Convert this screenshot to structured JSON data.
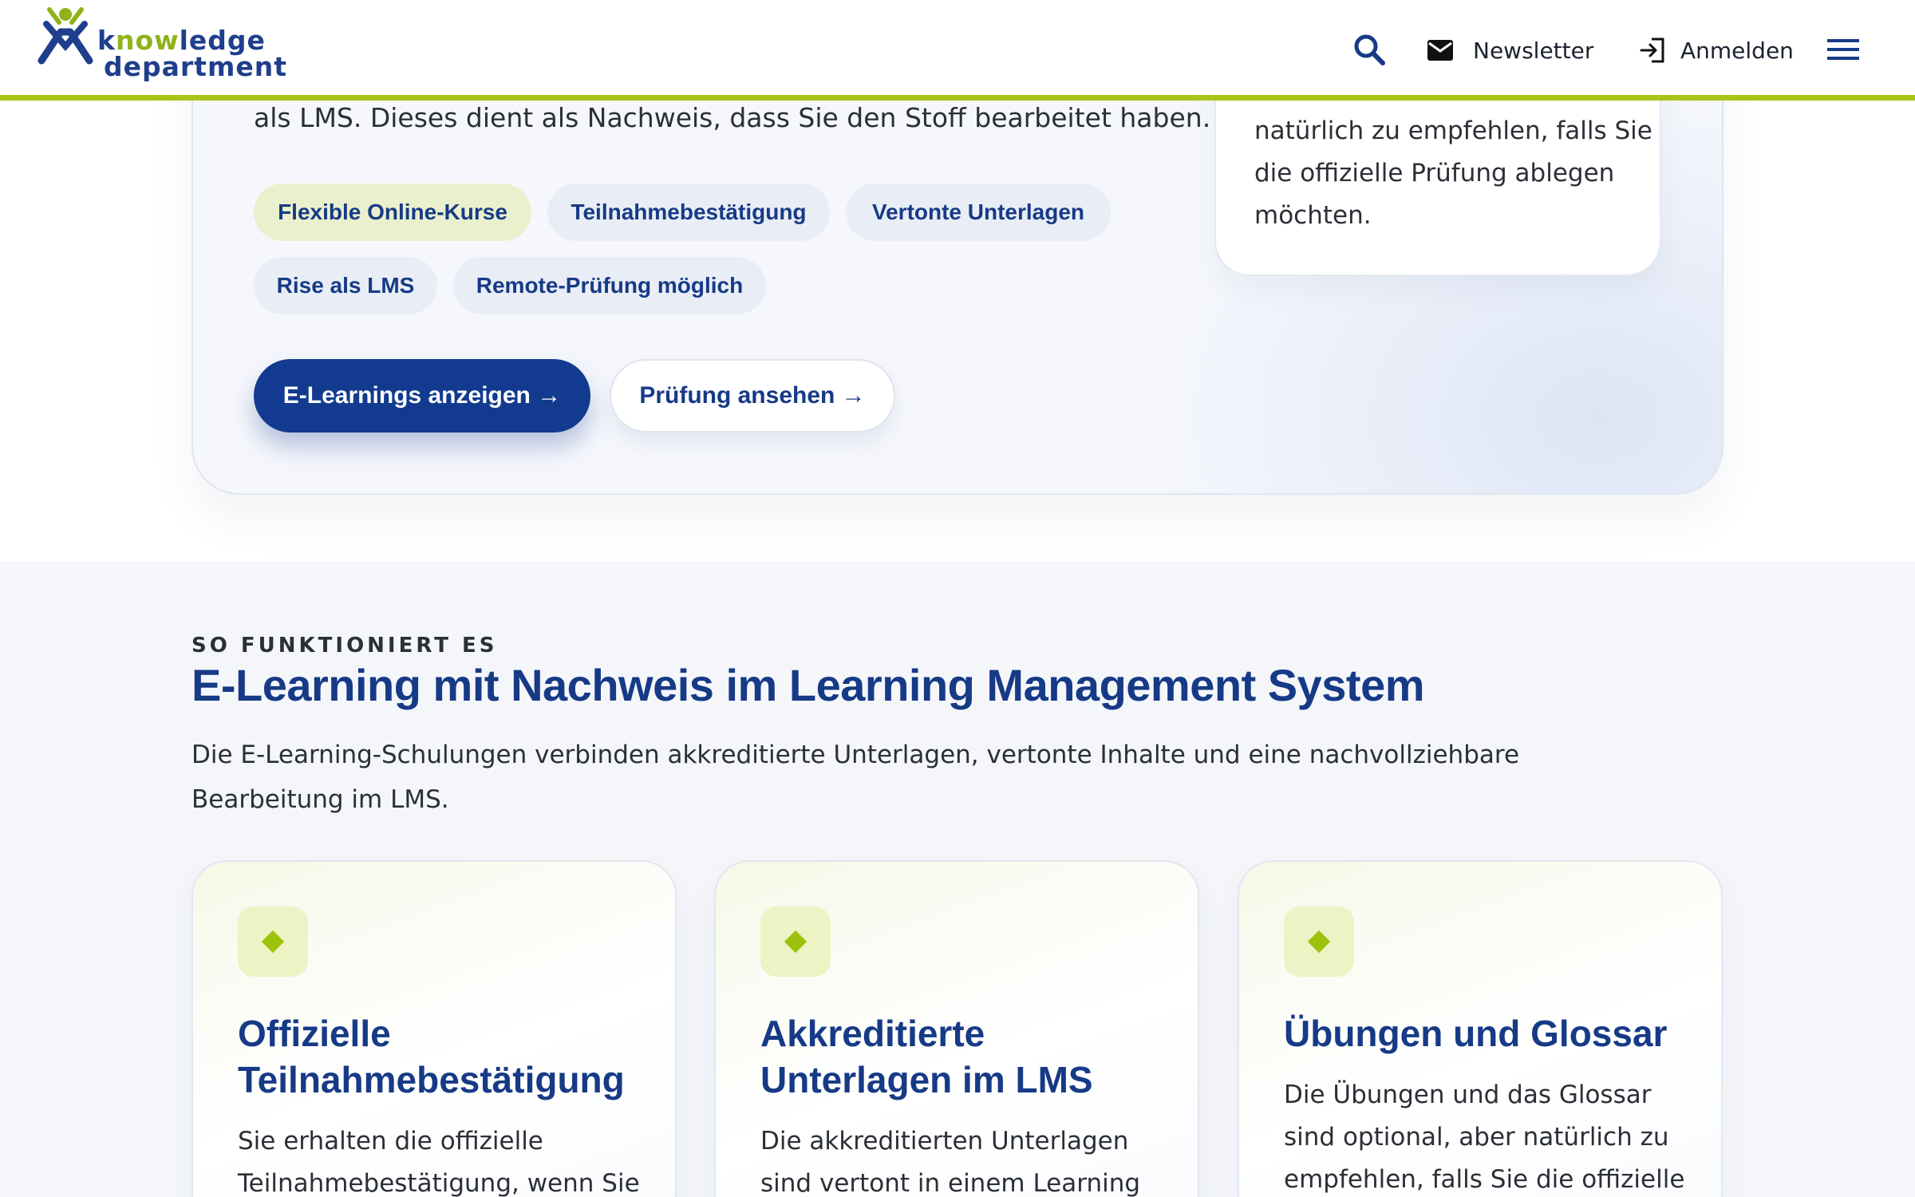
{
  "header": {
    "logo_line1_a": "k",
    "logo_line1_b": "now",
    "logo_line1_c": "ledge",
    "logo_line2": "department",
    "newsletter_label": "Newsletter",
    "login_label": "Anmelden"
  },
  "hero": {
    "text": "als LMS. Dieses dient als Nachweis, dass Sie den Stoff bearbeitet haben.",
    "chips": [
      "Flexible Online-Kurse",
      "Teilnahmebestätigung",
      "Vertonte Unterlagen",
      "Rise als LMS",
      "Remote-Prüfung möglich"
    ],
    "primary_button": "E-Learnings anzeigen →",
    "secondary_button": "Prüfung ansehen →",
    "side_card_text": "natürlich zu empfehlen, falls Sie die offizielle Prüfung ablegen möchten."
  },
  "section": {
    "eyebrow": "SO FUNKTIONIERT ES",
    "title": "E-Learning mit Nachweis im Learning Management System",
    "description": "Die E-Learning-Schulungen verbinden akkreditierte Unterlagen, vertonte Inhalte und eine nachvollziehbare Bearbeitung im LMS.",
    "features": [
      {
        "title": "Offizielle Teilnahmebestätigung",
        "text": "Sie erhalten die offizielle Teilnahmebestätigung, wenn Sie"
      },
      {
        "title": "Akkreditierte Unterlagen im LMS",
        "text": "Die akkreditierten Unterlagen sind vertont in einem Learning"
      },
      {
        "title": "Übungen und Glossar",
        "text": "Die Übungen und das Glossar sind optional, aber natürlich zu empfehlen, falls Sie die offizielle"
      }
    ]
  },
  "colors": {
    "brand_blue": "#163a86",
    "brand_green": "#a8c41a",
    "primary_button": "#123a8f"
  },
  "icons": [
    "logo-mark-icon",
    "search-icon",
    "mail-icon",
    "login-icon",
    "hamburger-menu-icon",
    "diamond-icon"
  ]
}
